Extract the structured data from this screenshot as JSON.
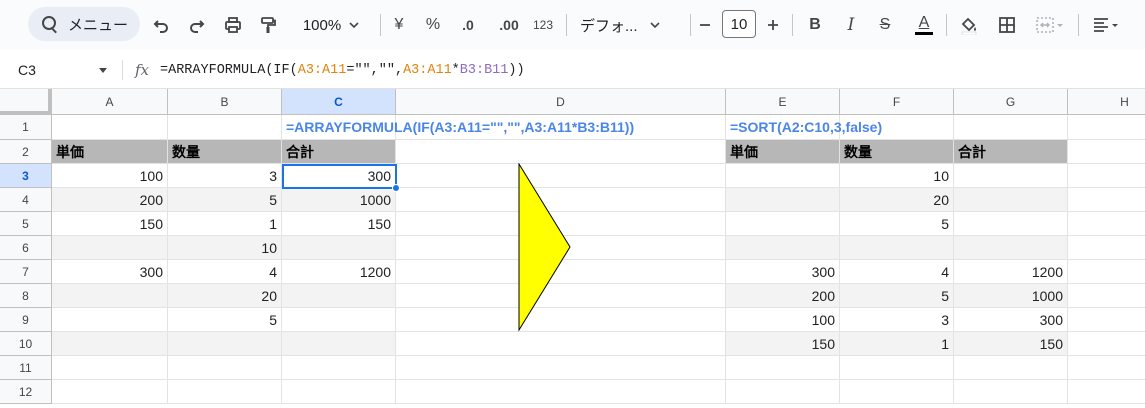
{
  "toolbar": {
    "menu_label": "メニュー",
    "zoom": "100%",
    "currency": "¥",
    "percent": "%",
    "decrease_decimal": ".0",
    "increase_decimal": ".00",
    "number_format": "123",
    "font_name": "デフォ...",
    "font_size": "10",
    "bold": "B",
    "italic": "I",
    "strike": "S",
    "text_color": "A"
  },
  "formula_bar": {
    "cell_ref": "C3",
    "fx": "fx",
    "parts": [
      "=ARRAYFORMULA(IF(",
      "A3:A11",
      "=\"\",\"\",",
      "A3:A11",
      "*",
      "B3:B11",
      "))"
    ]
  },
  "columns": [
    "A",
    "B",
    "C",
    "D",
    "E",
    "F",
    "G",
    "H"
  ],
  "rows": [
    "1",
    "2",
    "3",
    "4",
    "5",
    "6",
    "7",
    "8",
    "9",
    "10",
    "11",
    "12"
  ],
  "cells": {
    "C1": "=ARRAYFORMULA(IF(A3:A11=\"\",\"\",A3:A11*B3:B11))",
    "E1": "=SORT(A2:C10,3,false)",
    "A2": "単価",
    "B2": "数量",
    "C2": "合計",
    "E2": "単価",
    "F2": "数量",
    "G2": "合計",
    "A3": "100",
    "B3": "3",
    "C3": "300",
    "A4": "200",
    "B4": "5",
    "C4": "1000",
    "A5": "150",
    "B5": "1",
    "C5": "150",
    "B6": "10",
    "A7": "300",
    "B7": "4",
    "C7": "1200",
    "B8": "20",
    "B9": "5",
    "F3": "10",
    "F4": "20",
    "F5": "5",
    "E7": "300",
    "F7": "4",
    "G7": "1200",
    "E8": "200",
    "F8": "5",
    "G8": "1000",
    "E9": "100",
    "F9": "3",
    "G9": "300",
    "E10": "150",
    "F10": "1",
    "G10": "150"
  },
  "colors": {
    "header_fill": "#b7b7b7",
    "band_fill": "#f3f3f3",
    "formula_text": "#4a86e8",
    "selection": "#1a73e8",
    "arrow_fill": "#ffff00"
  },
  "shape": {
    "type": "triangle-right-arrow"
  }
}
